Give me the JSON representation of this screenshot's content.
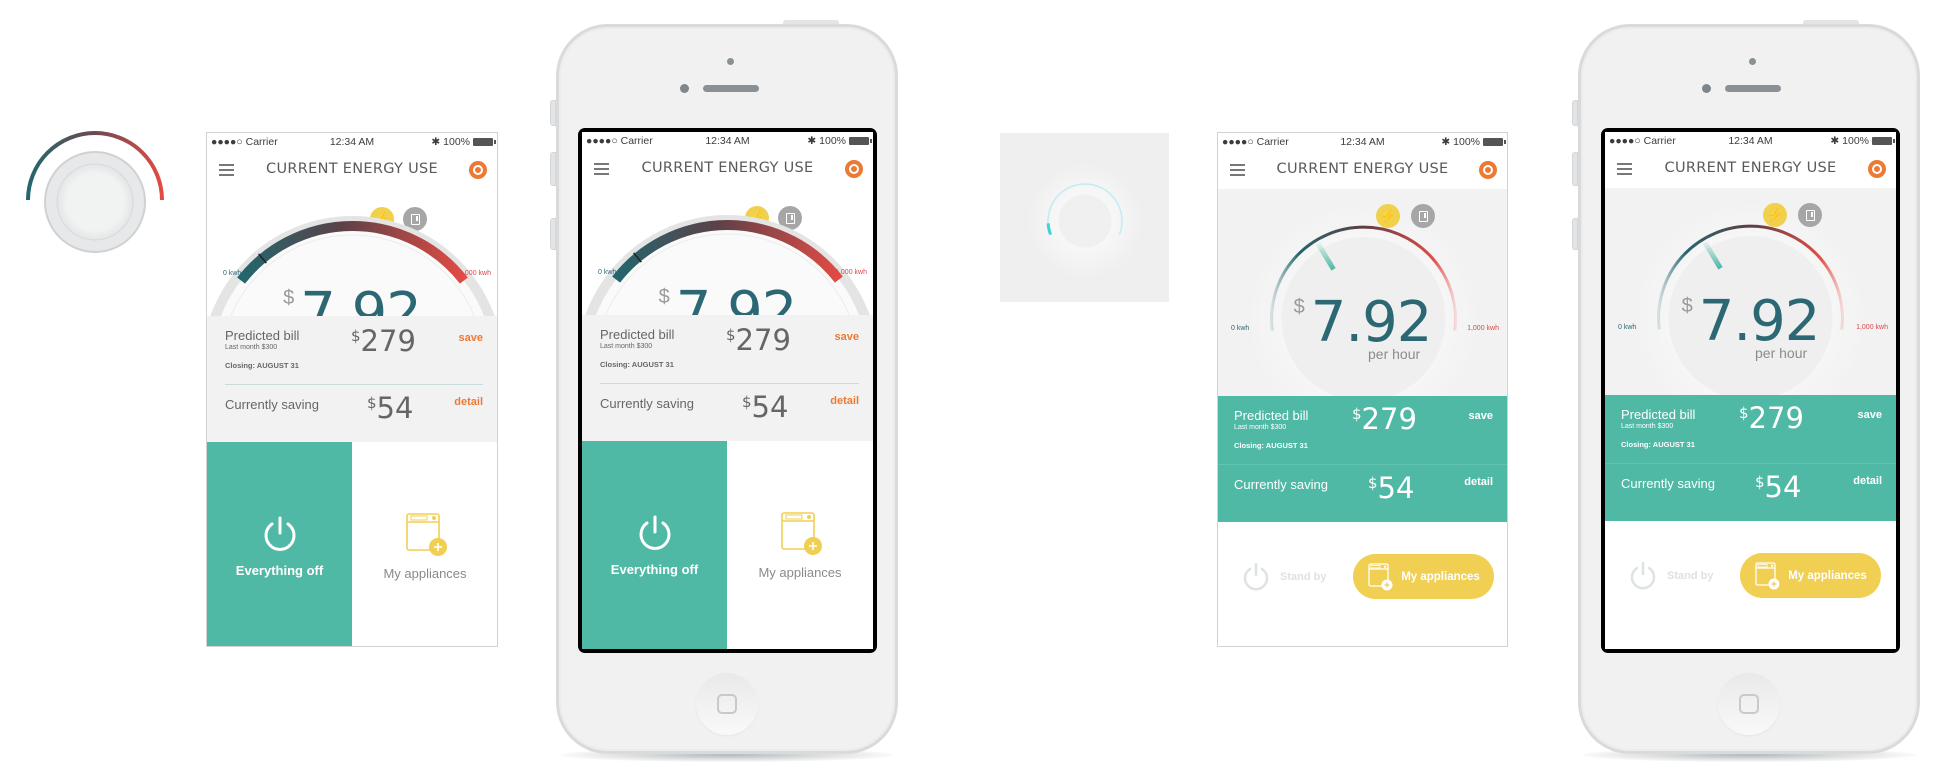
{
  "app": {
    "status_bar": {
      "carrier": "●●●●○ Carrier",
      "time": "12:34 AM",
      "battery": "100%"
    },
    "title": "CURRENT ENERGY USE",
    "icons": {
      "menu": "hamburger-icon",
      "power_record": "target-icon",
      "energy": "lightning-icon",
      "appliance": "appliance-icon"
    },
    "gauge": {
      "currency": "$",
      "value": "7.92",
      "unit": "per hour",
      "min_label": "0 kwh",
      "max_label": "1,000 kwh",
      "level_fraction": 0.12
    },
    "predicted_bill": {
      "label": "Predicted bill",
      "last_month": "Last month  $300",
      "closing": "Closing: AUGUST 31",
      "currency": "$",
      "amount": "279",
      "action": "save"
    },
    "currently_saving": {
      "label": "Currently saving",
      "currency": "$",
      "amount": "54",
      "action": "detail"
    },
    "actions": {
      "everything_off": "Everything off",
      "my_appliances": "My appliances",
      "stand_by": "Stand by",
      "plus": "+"
    }
  },
  "colors": {
    "teal": "#4fb9a6",
    "dark_teal": "#2c6873",
    "orange": "#ec7a34",
    "yellow": "#f0cf53",
    "red": "#d9484a",
    "spinner": "#3fd2dc"
  },
  "spinner": {
    "progress_fraction": 0.08
  }
}
